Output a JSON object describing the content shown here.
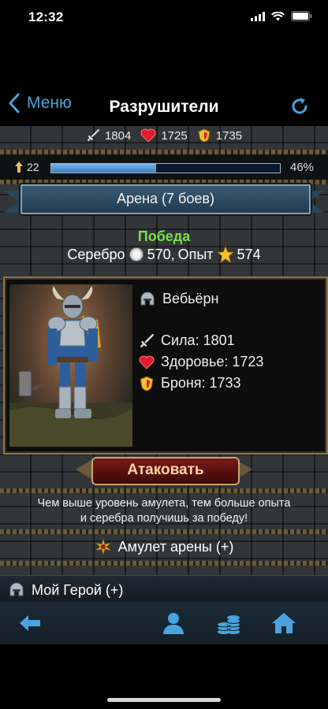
{
  "status": {
    "time": "12:32"
  },
  "nav": {
    "back_label": "Меню",
    "title": "Разрушители"
  },
  "player_stats": {
    "attack": "1804",
    "health": "1725",
    "armor": "1735"
  },
  "level": {
    "value": "22",
    "progress_fraction": 0.46,
    "progress_label": "46%"
  },
  "arena": {
    "banner": "Арена (7 боев)"
  },
  "result": {
    "label": "Победа",
    "silver_text": "Серебро",
    "silver_value": "570,",
    "exp_text": "Опыт",
    "exp_value": "574"
  },
  "opponent": {
    "name": "Вебьёрн",
    "strength": "Сила: 1801",
    "health": "Здоровье: 1723",
    "armor": "Броня: 1733"
  },
  "actions": {
    "attack": "Атаковать"
  },
  "hint": {
    "line1": "Чем выше уровень амулета, тем больше опыта",
    "line2": "и серебра получишь за победу!"
  },
  "amulet": {
    "label": "Амулет арены (+)"
  },
  "hero": {
    "label": "Мой Герой (+)"
  },
  "colors": {
    "accent": "#4aa3df",
    "victory": "#79e04a",
    "progress": "#5a9bd8"
  },
  "icons": {
    "back": "chevron-left-icon",
    "refresh": "refresh-icon",
    "sword": "sword-icon",
    "heart": "heart-icon",
    "shield": "shield-icon",
    "arrow_up": "arrow-up-icon",
    "coin": "silver-coin-icon",
    "star": "star-icon",
    "helmet": "helmet-icon",
    "amulet": "amulet-icon",
    "tab_back": "arrow-left-icon",
    "tab_profile": "person-icon",
    "tab_coins": "coins-icon",
    "tab_home": "home-icon"
  }
}
